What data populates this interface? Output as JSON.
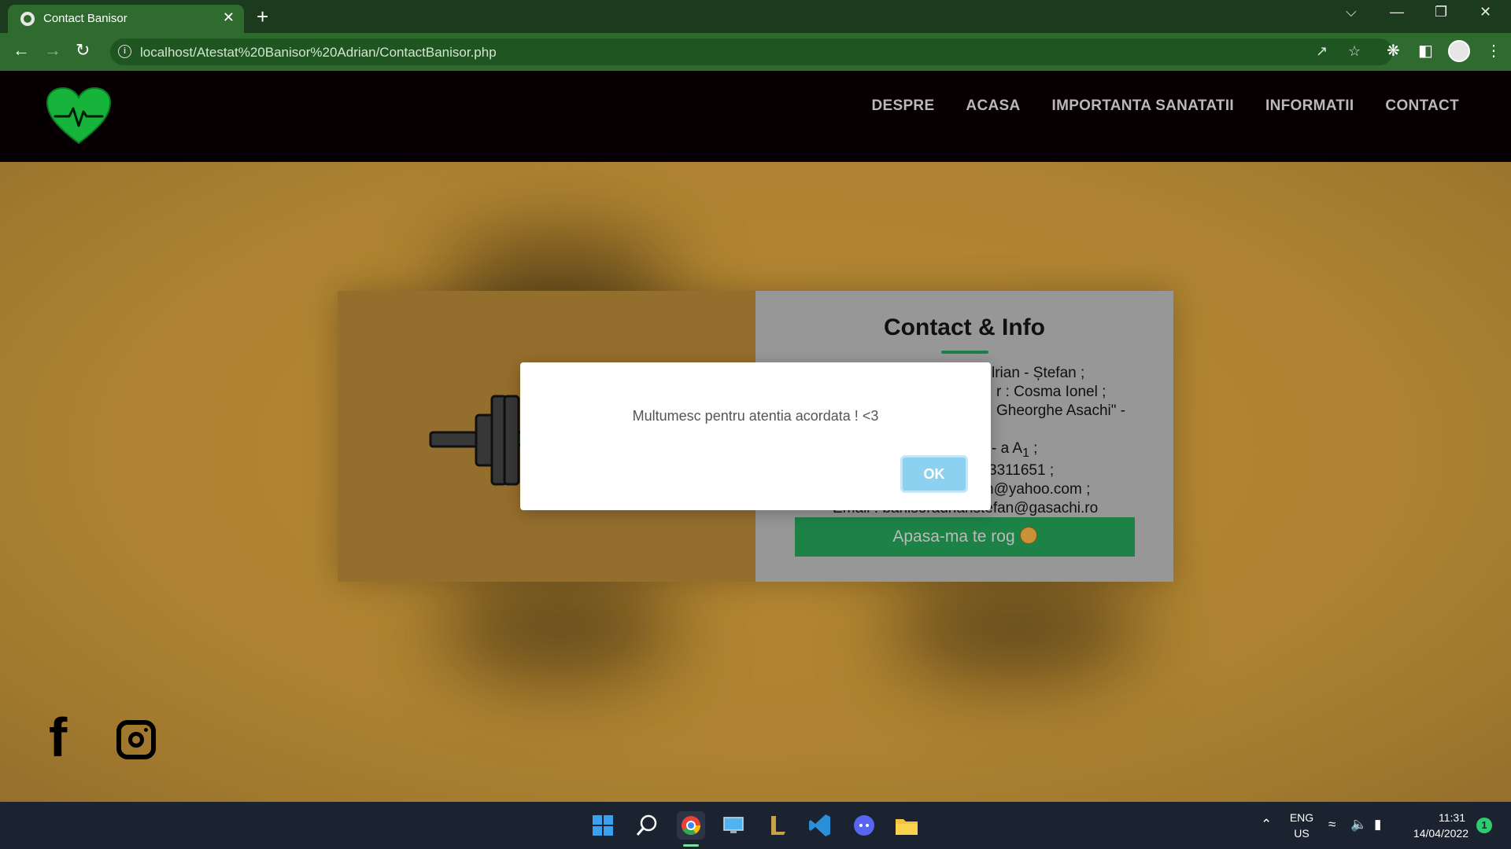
{
  "browser": {
    "tab_title": "Contact Banisor",
    "tab_close": "✕",
    "new_tab": "+",
    "url": "localhost/Atestat%20Banisor%20Adrian/ContactBanisor.php",
    "window": {
      "chevron": "⌵",
      "minimize": "—",
      "restore": "❐",
      "close": "✕"
    }
  },
  "site": {
    "nav": [
      "DESPRE",
      "ACASA",
      "IMPORTANTA SANATATII",
      "INFORMATII",
      "CONTACT"
    ],
    "contact": {
      "title": "Contact & Info",
      "lines": [
        "lrian - Ștefan ;",
        "r : Cosma Ionel ;",
        "Gheorghe Asachi\" -",
        "- a A",
        "3311651 ;",
        "n@yahoo.com ;",
        "Email : banisoradrianstefan@gasachi.ro"
      ],
      "line4_sub": "1",
      "line4_end": " ;",
      "button": "Apasa-ma te rog"
    },
    "socials": {
      "facebook": "f"
    }
  },
  "modal": {
    "message": "Multumesc pentru atentia acordata ! <3",
    "ok": "OK"
  },
  "taskbar": {
    "lang_top": "ENG",
    "lang_bottom": "US",
    "time": "11:31",
    "date": "14/04/2022",
    "notifications": "1"
  },
  "colors": {
    "page_bg": "#b88a36",
    "header_bg": "#070003",
    "accent_green": "#1e8a4a",
    "logo_green": "#16b43a",
    "ok_blue": "#8dd1f0"
  }
}
